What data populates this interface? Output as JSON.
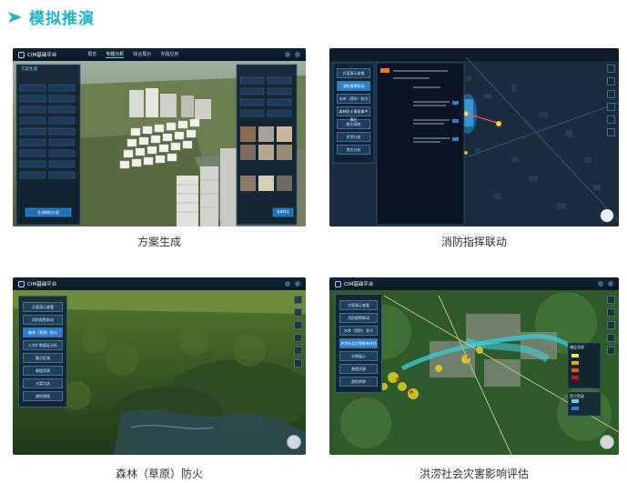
{
  "header": {
    "title": "模拟推演",
    "icon": "chevron-right-icon",
    "accent": "#1fb3c7"
  },
  "cards": [
    {
      "caption": "方案生成",
      "app_title": "CIM基础平台",
      "nav": [
        "概览",
        "专题分析",
        "综合展示",
        "专题应用"
      ],
      "panel_title": "方案生成",
      "panel_button": "生成模拟方案",
      "panel_button_right": "选择样式"
    },
    {
      "caption": "消防指挥联动",
      "menu": [
        "方案演示查看",
        "消防报警联动",
        "水库（堤防）防汛",
        "森林防火事前事中事后",
        "救灾演练",
        "洪涝分析",
        "地灾分析"
      ]
    },
    {
      "caption": "森林（草原）防火",
      "app_title": "CIM基础平台",
      "menu": [
        "方案演示查看",
        "消防报警联动",
        "森林（草原）防火",
        "火灾扩散蔓延分析",
        "重点区域",
        "救援资源",
        "方案比选",
        "避险救援"
      ]
    },
    {
      "caption": "洪涝社会灾害影响评估",
      "app_title": "CIM基础平台",
      "menu": [
        "方案演示查看",
        "消防报警联动",
        "水库（堤防）防汛",
        "洪涝社会灾害影响评估",
        "灾情展示",
        "救援资源",
        "避险转移"
      ],
      "legend_title": "淹没深度",
      "legend_title2": "受灾等级"
    }
  ]
}
